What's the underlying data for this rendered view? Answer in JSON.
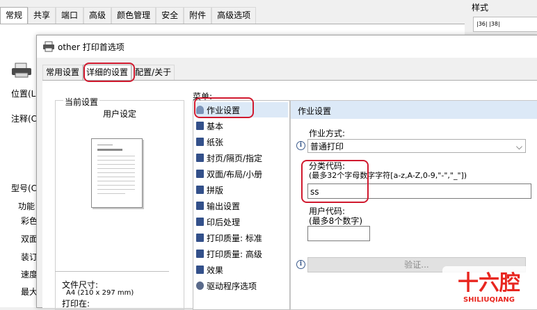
{
  "back_window": {
    "tabs": [
      "常规",
      "共享",
      "端口",
      "高级",
      "颜色管理",
      "安全",
      "附件",
      "高级选项"
    ],
    "labels": {
      "location": "位置(L",
      "comment": "注释(C",
      "model": "型号(C",
      "features": "功能",
      "color": "彩色",
      "duplex": "双面",
      "staple": "装订",
      "speed": "速度",
      "max": "最大"
    },
    "style_label": "样式",
    "ruler_text": "|36|  |38|"
  },
  "dialog": {
    "title": "other 打印首选项",
    "tabs": [
      "常用设置",
      "详细的设置",
      "配置/关于"
    ],
    "current_settings": {
      "title": "当前设置",
      "name": "用户设定",
      "file_size_label": "文件尺寸:",
      "file_size_value": "A4 (210 x 297 mm)",
      "print_on_label": "打印在:"
    },
    "menu": {
      "label": "菜单:",
      "items": [
        "作业设置",
        "基本",
        "纸张",
        "封页/隔页/指定",
        "双面/布局/小册",
        "拼版",
        "输出设置",
        "印后处理",
        "打印质量: 标准",
        "打印质量: 高级",
        "效果",
        "驱动程序选项"
      ]
    },
    "panel": {
      "title": "作业设置",
      "job_mode_label": "作业方式:",
      "job_mode_value": "普通打印",
      "class_code_label": "分类代码:",
      "class_code_hint": "(最多32个字母数字字符[a-z,A-Z,0-9,\"-\",\"_\"])",
      "class_code_value": "ss",
      "user_code_label": "用户代码:",
      "user_code_hint": "(最多8个数字)",
      "user_code_value": "",
      "verify_button": "验证..."
    }
  },
  "watermark": {
    "text": "十六腔",
    "subtext": "SHILIUQIANG",
    "color": "#e8261f"
  },
  "colors": {
    "highlight": "#d0192e",
    "selection": "#dce9f7"
  }
}
